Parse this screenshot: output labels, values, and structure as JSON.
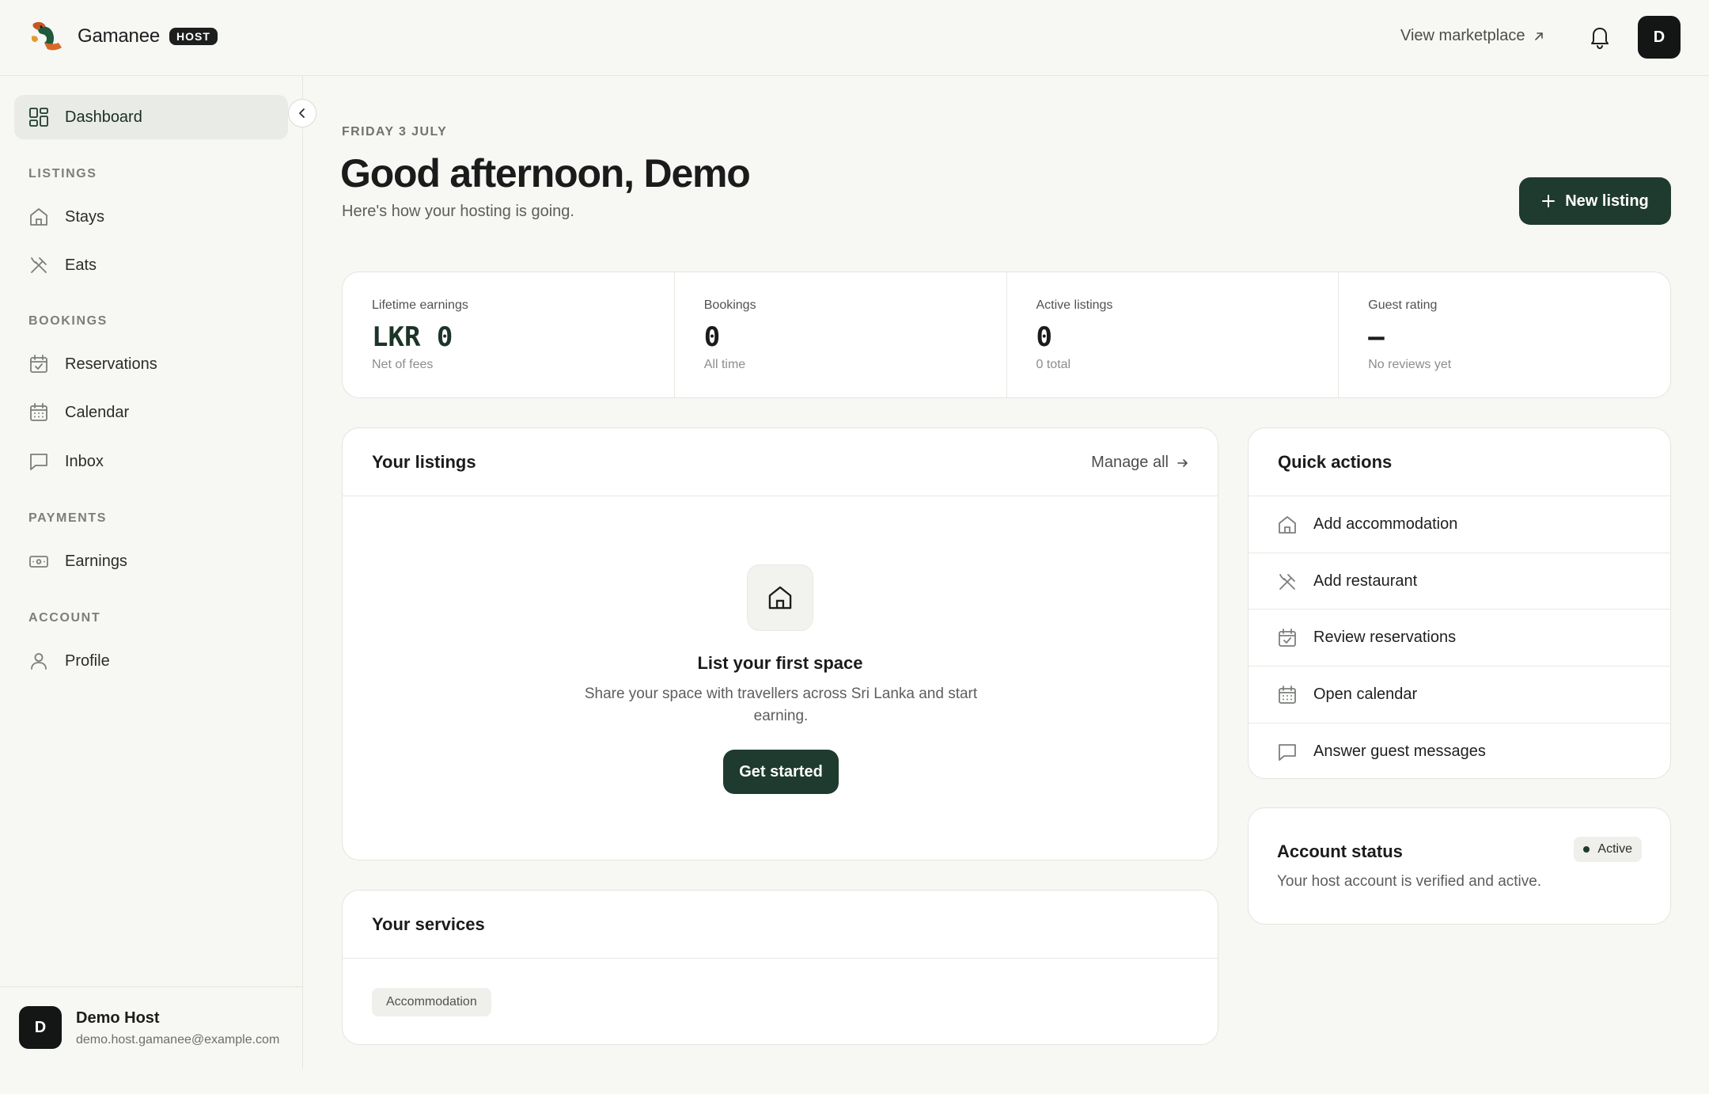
{
  "brand": {
    "name": "Gamanee",
    "badge": "HOST"
  },
  "topbar": {
    "view_marketplace": "View marketplace",
    "avatar_initial": "D"
  },
  "sidebar": {
    "dashboard": "Dashboard",
    "sections": {
      "listings": "LISTINGS",
      "bookings": "BOOKINGS",
      "payments": "PAYMENTS",
      "account": "ACCOUNT"
    },
    "items": {
      "stays": "Stays",
      "eats": "Eats",
      "reservations": "Reservations",
      "calendar": "Calendar",
      "inbox": "Inbox",
      "earnings": "Earnings",
      "profile": "Profile"
    },
    "user": {
      "initial": "D",
      "name": "Demo Host",
      "email": "demo.host.gamanee@example.com"
    }
  },
  "header": {
    "date": "FRIDAY 3 JULY",
    "greeting": "Good afternoon, Demo",
    "subtitle": "Here's how your hosting is going.",
    "new_listing": "New listing"
  },
  "stats": [
    {
      "label": "Lifetime earnings",
      "value": "LKR 0",
      "sub": "Net of fees"
    },
    {
      "label": "Bookings",
      "value": "0",
      "sub": "All time"
    },
    {
      "label": "Active listings",
      "value": "0",
      "sub": "0 total"
    },
    {
      "label": "Guest rating",
      "value": "–",
      "sub": "No reviews yet"
    }
  ],
  "listings": {
    "title": "Your listings",
    "manage_all": "Manage all",
    "empty_title": "List your first space",
    "empty_desc": "Share your space with travellers across Sri Lanka and start earning.",
    "cta": "Get started"
  },
  "services": {
    "title": "Your services",
    "tags": [
      "Accommodation"
    ]
  },
  "quick_actions": {
    "title": "Quick actions",
    "items": [
      {
        "label": "Add accommodation",
        "icon": "home-icon"
      },
      {
        "label": "Add restaurant",
        "icon": "utensils-icon"
      },
      {
        "label": "Review reservations",
        "icon": "calendar-check-icon"
      },
      {
        "label": "Open calendar",
        "icon": "calendar-icon"
      },
      {
        "label": "Answer guest messages",
        "icon": "message-icon"
      }
    ]
  },
  "account_status": {
    "title": "Account status",
    "status": "Active",
    "description": "Your host account is verified and active."
  },
  "colors": {
    "accent": "#1f3a2e",
    "background": "#f7f7f4",
    "card": "#ffffff"
  }
}
